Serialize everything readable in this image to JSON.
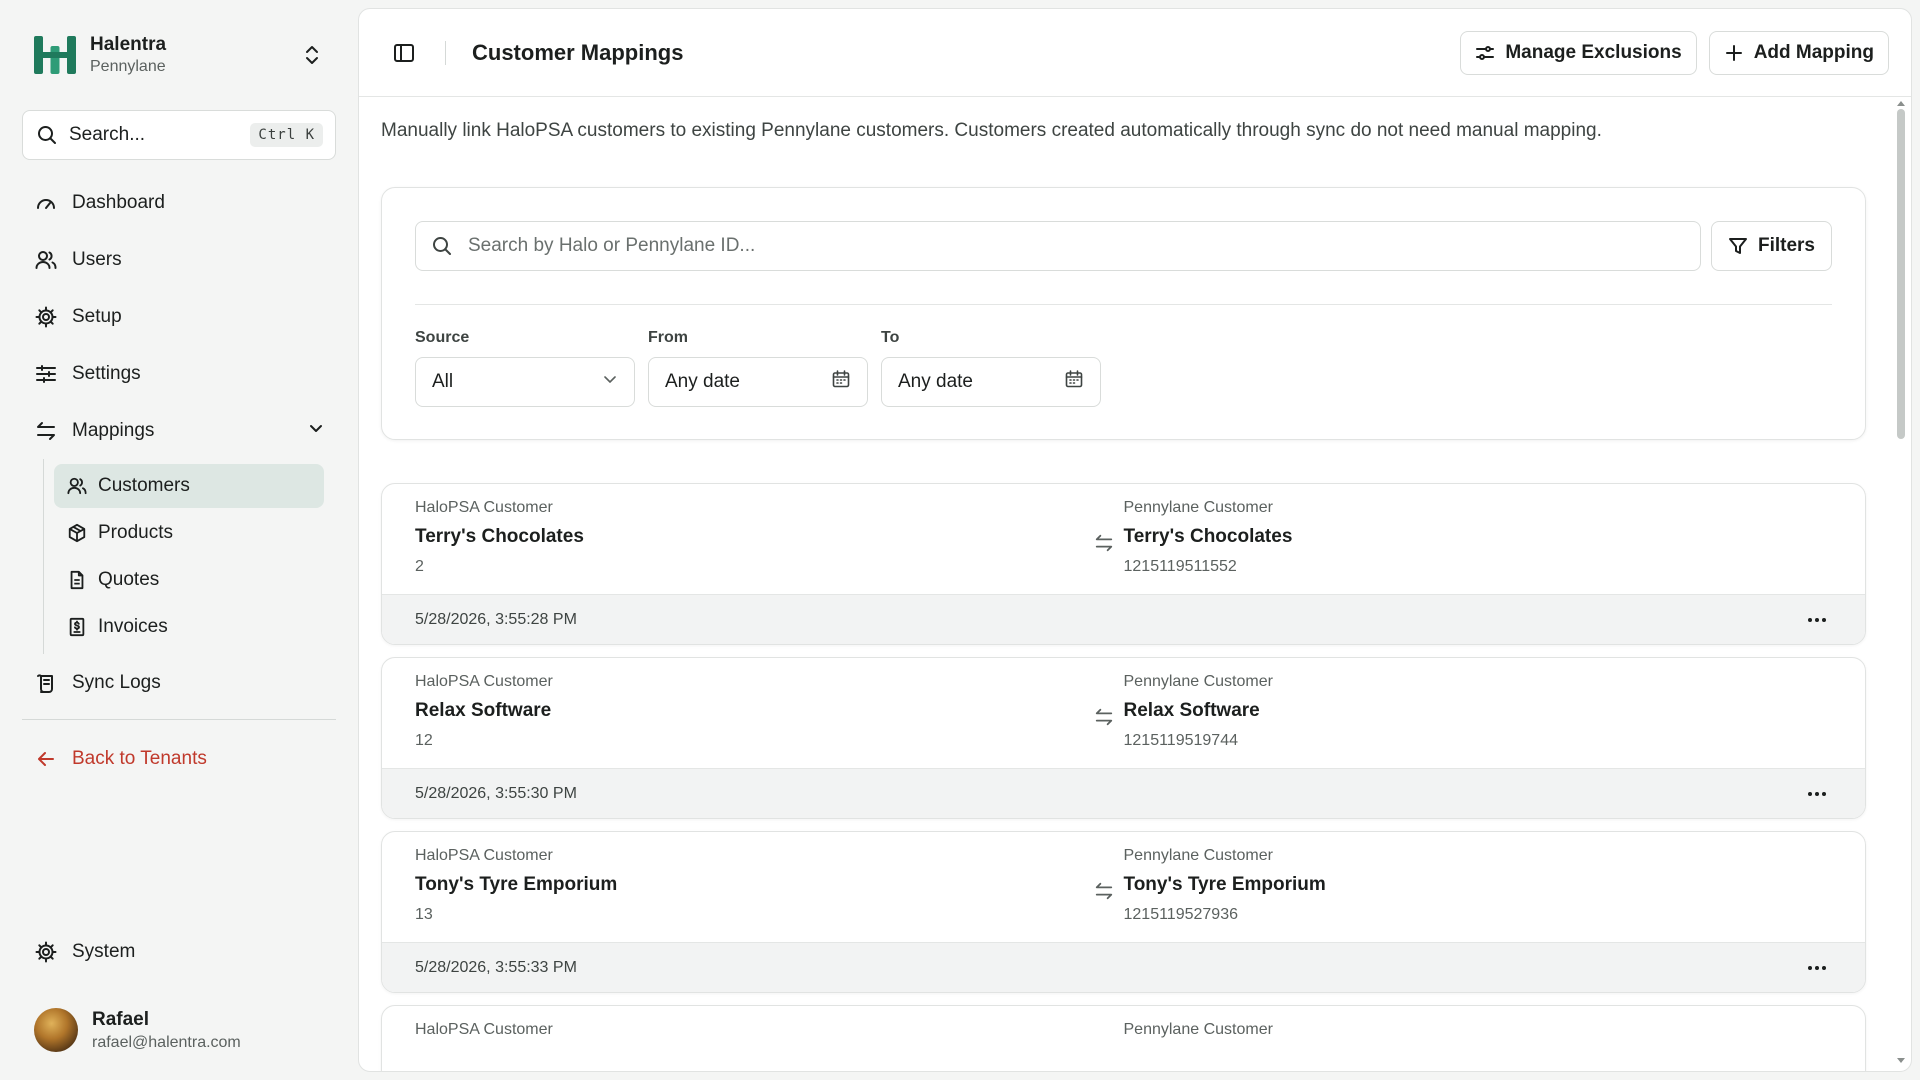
{
  "brand": {
    "name": "Halentra",
    "tenant": "Pennylane",
    "logo_color": "#1f7a5c"
  },
  "search": {
    "label": "Search...",
    "shortcut": "Ctrl K"
  },
  "nav": {
    "dashboard": "Dashboard",
    "users": "Users",
    "setup": "Setup",
    "settings": "Settings",
    "mappings": "Mappings",
    "sub": {
      "customers": "Customers",
      "products": "Products",
      "quotes": "Quotes",
      "invoices": "Invoices"
    },
    "sync_logs": "Sync Logs",
    "back": "Back to Tenants",
    "system": "System"
  },
  "user": {
    "name": "Rafael",
    "email": "rafael@halentra.com"
  },
  "header": {
    "title": "Customer Mappings",
    "manage_exclusions": "Manage Exclusions",
    "add_mapping": "Add Mapping"
  },
  "description": "Manually link HaloPSA customers to existing Pennylane customers. Customers created automatically through sync do not need manual mapping.",
  "filters": {
    "search_placeholder": "Search by Halo or Pennylane ID...",
    "button": "Filters",
    "source_label": "Source",
    "source_value": "All",
    "from_label": "From",
    "from_value": "Any date",
    "to_label": "To",
    "to_value": "Any date"
  },
  "mappings": [
    {
      "halo_label": "HaloPSA Customer",
      "halo_name": "Terry's Chocolates",
      "halo_id": "2",
      "penny_label": "Pennylane Customer",
      "penny_name": "Terry's Chocolates",
      "penny_id": "1215119511552",
      "timestamp": "5/28/2026, 3:55:28 PM"
    },
    {
      "halo_label": "HaloPSA Customer",
      "halo_name": "Relax Software",
      "halo_id": "12",
      "penny_label": "Pennylane Customer",
      "penny_name": "Relax Software",
      "penny_id": "1215119519744",
      "timestamp": "5/28/2026, 3:55:30 PM"
    },
    {
      "halo_label": "HaloPSA Customer",
      "halo_name": "Tony's Tyre Emporium",
      "halo_id": "13",
      "penny_label": "Pennylane Customer",
      "penny_name": "Tony's Tyre Emporium",
      "penny_id": "1215119527936",
      "timestamp": "5/28/2026, 3:55:33 PM"
    },
    {
      "halo_label": "HaloPSA Customer",
      "halo_name": "",
      "halo_id": "",
      "penny_label": "Pennylane Customer",
      "penny_name": "",
      "penny_id": "",
      "timestamp": ""
    }
  ]
}
